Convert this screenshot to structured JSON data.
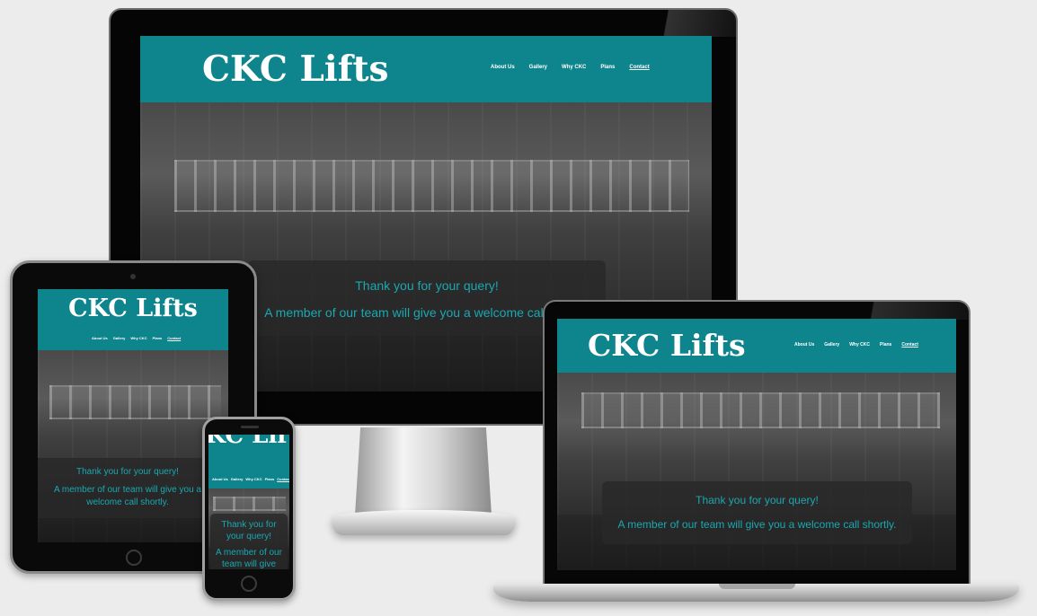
{
  "site": {
    "brand": "CKC Lifts",
    "nav": [
      {
        "label": "About Us",
        "active": false
      },
      {
        "label": "Gallery",
        "active": false
      },
      {
        "label": "Why CKC",
        "active": false
      },
      {
        "label": "Plans",
        "active": false
      },
      {
        "label": "Contact",
        "active": true
      }
    ],
    "message": {
      "heading": "Thank you for your query!",
      "body": "A member of our team will give you a welcome call shortly."
    },
    "tablet_message_body_lines": [
      "A member of our team will give you a",
      "welcome call shortly."
    ],
    "phone_message_heading_lines": [
      "Thank you for",
      "your query!"
    ],
    "phone_message_body_lines": [
      "A member of our",
      "team will give"
    ],
    "colors": {
      "header": "#0e858d",
      "accent_text": "#1aa8b1",
      "brand_text": "#ffffff"
    }
  },
  "devices": [
    "desktop-monitor",
    "tablet",
    "phone",
    "laptop"
  ]
}
